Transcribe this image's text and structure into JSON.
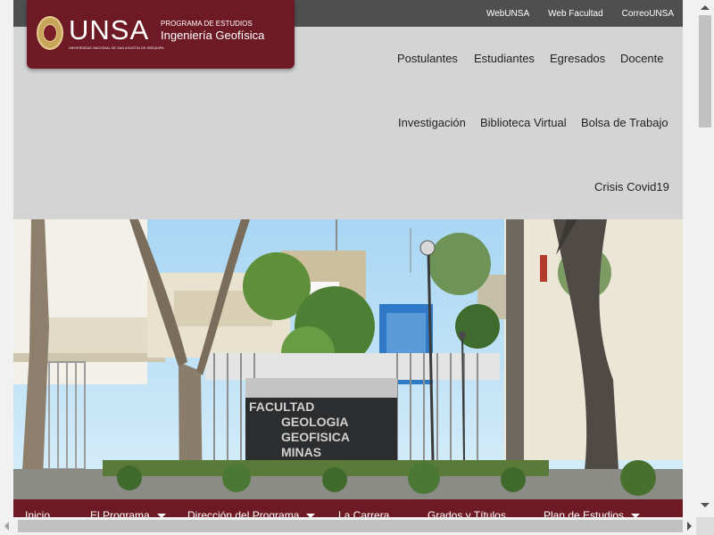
{
  "topbar": {
    "links": [
      "WebUNSA",
      "Web Facultad",
      "CorreoUNSA"
    ]
  },
  "brand": {
    "logo_text": "UNSA",
    "logo_subtext": "UNIVERSIDAD NACIONAL DE SAN AGUSTIN DE AREQUIPA",
    "program_caption": "PROGRAMA DE ESTUDIOS",
    "program_name": "Ingeniería Geofísica"
  },
  "main_nav": {
    "items": [
      "Postulantes",
      "Estudiantes",
      "Egresados",
      "Docente",
      "Investigación",
      "Biblioteca Virtual",
      "Bolsa de Trabajo",
      "Crisis Covid19"
    ]
  },
  "hero": {
    "sign_lines": [
      "FACULTAD",
      "GEOLOGIA",
      "GEOFISICA",
      "MINAS"
    ]
  },
  "menu_bar": {
    "items": [
      {
        "label": "Inicio",
        "dropdown": false
      },
      {
        "label": "El Programa",
        "dropdown": true
      },
      {
        "label": "Dirección del Programa",
        "dropdown": true
      },
      {
        "label": "La Carrera",
        "dropdown": false
      },
      {
        "label": "Grados y Títulos",
        "dropdown": false
      },
      {
        "label": "Plan de Estudios",
        "dropdown": true
      }
    ]
  },
  "colors": {
    "brand_maroon": "#6e1a25",
    "topbar_gray": "#4f4f4f",
    "header_gray": "#d4d4d4"
  }
}
